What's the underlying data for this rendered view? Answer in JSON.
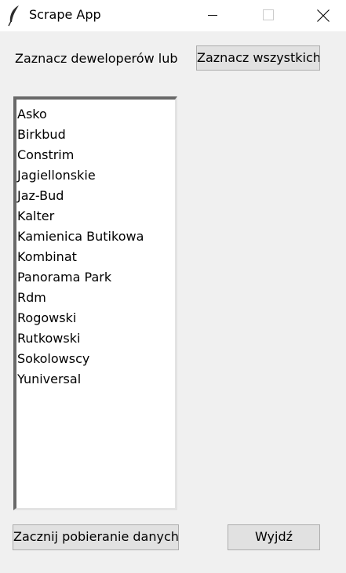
{
  "window": {
    "title": "Scrape App",
    "icon": "feather-icon",
    "controls": [
      "minimize-icon",
      "maximize-icon",
      "close-icon"
    ]
  },
  "prompt": {
    "label": "Zaznacz deweloperów lub"
  },
  "buttons": {
    "select_all": "Zaznacz wszystkich",
    "start": "Zacznij pobieranie danych",
    "exit": "Wyjdź"
  },
  "developers": {
    "items": [
      "Asko",
      "Birkbud",
      "Constrim",
      "Jagiellonskie",
      "Jaz-Bud",
      "Kalter",
      "Kamienica Butikowa",
      "Kombinat",
      "Panorama Park",
      "Rdm",
      "Rogowski",
      "Rutkowski",
      "Sokolowscy",
      "Yuniversal"
    ]
  },
  "colors": {
    "window_bg": "#f0f0f0",
    "titlebar_bg": "#ffffff",
    "button_bg": "#e1e1e1",
    "button_border": "#adadad"
  }
}
